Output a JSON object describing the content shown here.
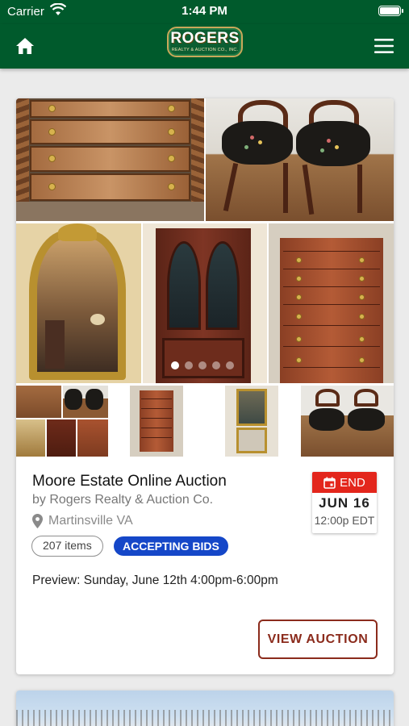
{
  "status_bar": {
    "carrier": "Carrier",
    "time": "1:44 PM"
  },
  "header": {
    "home_icon": "home-icon",
    "menu_icon": "hamburger-menu-icon",
    "logo": {
      "main": "ROGERS",
      "sub": "REALTY & AUCTION CO., INC."
    }
  },
  "auction": {
    "title": "Moore Estate Online Auction",
    "byline": "by Rogers Realty & Auction Co.",
    "location": "Martinsville VA",
    "items_count": "207 items",
    "status": "ACCEPTING BIDS",
    "preview": "Preview: Sunday, June 12th 4:00pm-6:00pm",
    "end_label": "END",
    "end_date": "JUN 16",
    "end_time": "12:00p EDT",
    "view_button": "VIEW AUCTION"
  },
  "gallery": {
    "photos": [
      "dresser",
      "needlepoint-chairs",
      "gilt-mirror",
      "corner-cabinet",
      "highboy-chest"
    ],
    "active_dot": 0,
    "dot_count": 5
  },
  "colors": {
    "header_green": "#005a2c",
    "accent_red": "#e3261c",
    "status_blue": "#1547c8",
    "button_brown": "#8b2b1c"
  }
}
